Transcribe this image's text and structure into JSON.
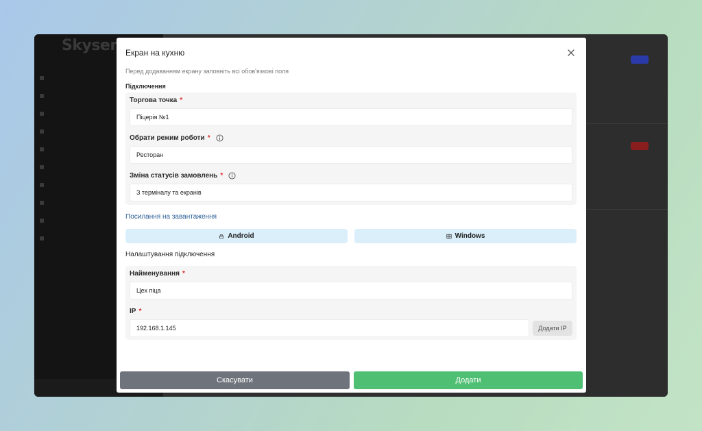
{
  "background_app": {
    "brand": "Skyservice",
    "sidebar_items": [
      "",
      "",
      "",
      "",
      "",
      "",
      "",
      "",
      "",
      "",
      ""
    ]
  },
  "modal": {
    "title": "Екран на кухню",
    "subtitle": "Перед додаванням екрану заповніть всі обов'язкові поля",
    "connection_section": "Підключення",
    "fields": {
      "outlet": {
        "label": "Торгова точка",
        "required": "*",
        "value": "Піцерія №1"
      },
      "work_mode": {
        "label": "Обрати режим роботи",
        "required": "*",
        "value": "Ресторан"
      },
      "status_change": {
        "label": "Зміна статусів замовлень",
        "required": "*",
        "value": "З терміналу та екранів"
      }
    },
    "downloads_heading": "Посилання на завантаження",
    "downloads": {
      "android_label": "Android",
      "windows_label": "Windows"
    },
    "connection_settings_heading": "Налаштування підключення",
    "settings_fields": {
      "name": {
        "label": "Найменування",
        "required": "*",
        "value": "Цех піца"
      },
      "ip": {
        "label": "IP",
        "required": "*",
        "value": "192.168.1.145"
      }
    },
    "add_ip_label": "Додати IP",
    "cancel_label": "Скасувати",
    "submit_label": "Додати"
  },
  "colors": {
    "submit": "#4fbf73",
    "cancel": "#6f747c",
    "download_button": "#dbeffb",
    "link": "#2a5c94",
    "required": "#e02a2a"
  },
  "icons": {
    "close": "close-icon",
    "info": "info-icon",
    "android": "android-icon",
    "windows": "windows-icon"
  }
}
